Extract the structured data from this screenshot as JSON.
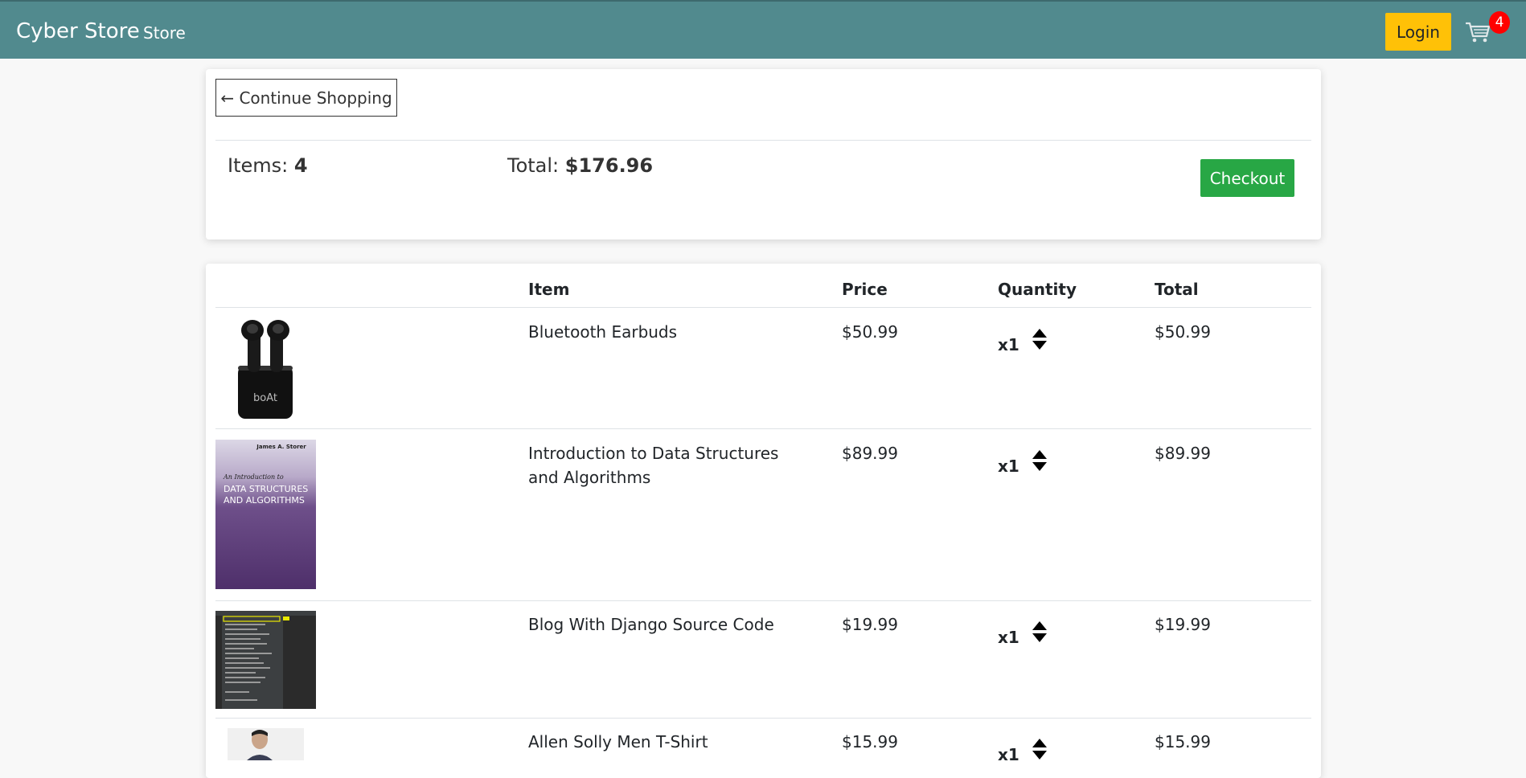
{
  "navbar": {
    "brand": "Cyber Store",
    "store_link": "Store",
    "login_label": "Login",
    "cart_icon": "cart-icon",
    "cart_count": "4"
  },
  "summary": {
    "continue_label": "← Continue Shopping",
    "items_label": "Items: ",
    "items_value": "4",
    "total_label": "Total: ",
    "total_value": "$176.96",
    "checkout_label": "Checkout"
  },
  "table": {
    "headers": [
      "Item",
      "Price",
      "Quantity",
      "Total"
    ],
    "rows": [
      {
        "name": "Bluetooth Earbuds",
        "price": "$50.99",
        "quantity": "x1",
        "total": "$50.99"
      },
      {
        "name": "Introduction to Data Structures and Algorithms",
        "price": "$89.99",
        "quantity": "x1",
        "total": "$89.99"
      },
      {
        "name": "Blog With Django Source Code",
        "price": "$19.99",
        "quantity": "x1",
        "total": "$19.99"
      },
      {
        "name": "Allen Solly Men T-Shirt",
        "price": "$15.99",
        "quantity": "x1",
        "total": "$15.99"
      }
    ]
  },
  "book_cover": {
    "author": "James A. Storer",
    "subtitle": "An Introduction to",
    "title_line1": "DATA STRUCTURES",
    "title_line2": "AND ALGORITHMS"
  },
  "earbuds_brand": "boAt",
  "colors": {
    "navbar": "#518a8e",
    "login": "#ffc107",
    "checkout": "#28a745",
    "badge": "#ff0000"
  }
}
